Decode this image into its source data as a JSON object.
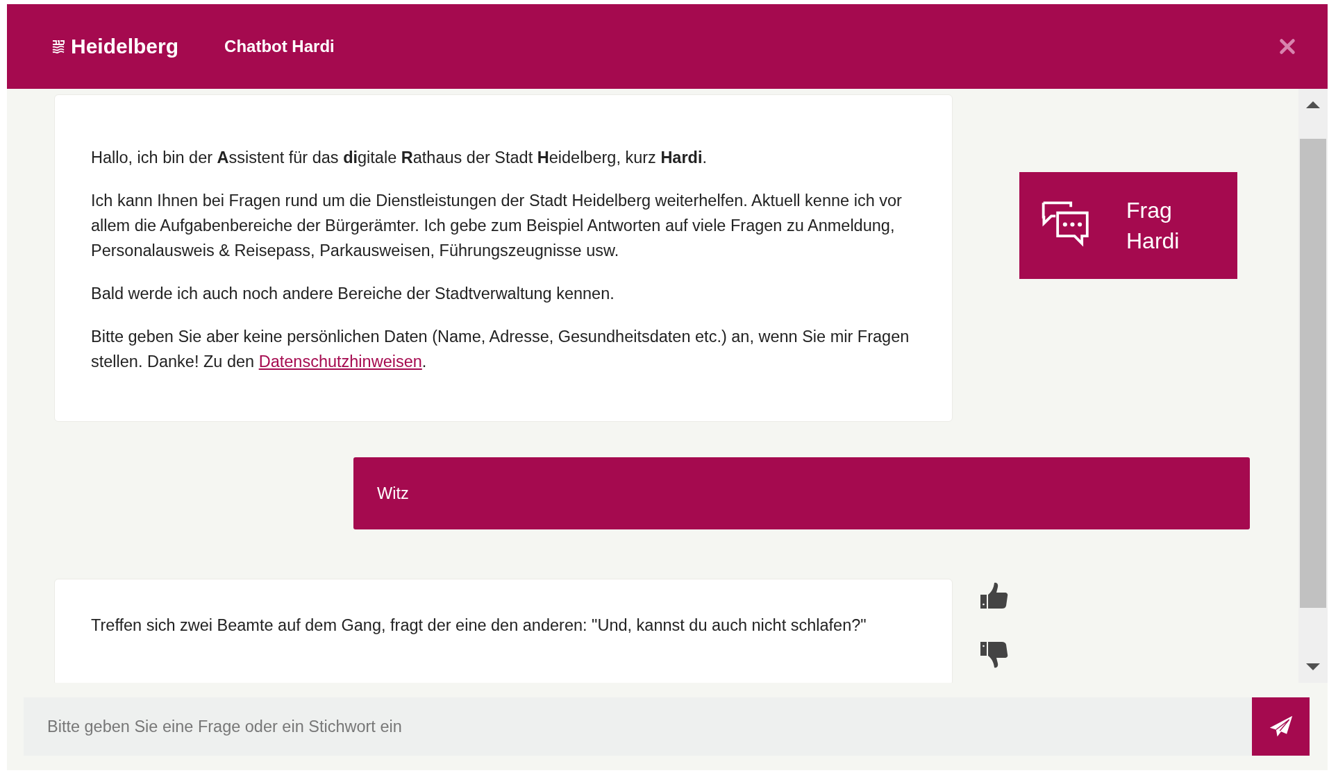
{
  "header": {
    "logo": "Heidelberg",
    "title": "Chatbot Hardi"
  },
  "messages": [
    {
      "kind": "bot",
      "paragraphs": [
        {
          "text": "Hallo, ich bin der **A**ssistent für das **di**gitale **R**athaus der Stadt **H**eidelberg, kurz **Hardi**."
        },
        {
          "text": "Ich kann Ihnen bei Fragen rund um die Dienstleistungen der Stadt Heidelberg weiterhelfen. Aktuell kenne ich vor allem die Aufgabenbereiche der Bürgerämter. Ich gebe zum Beispiel Antworten auf viele Fragen zu Anmeldung, Personalausweis & Reisepass, Parkausweisen, Führungszeugnisse usw."
        },
        {
          "text": "Bald werde ich auch noch andere Bereiche der Stadtverwaltung kennen."
        },
        {
          "text": "Bitte geben Sie aber keine persönlichen Daten (Name, Adresse, Gesundheitsdaten etc.) an, wenn Sie mir Fragen stellen. Danke! Zu den ",
          "link": "Datenschutzhinweisen",
          "after": "."
        }
      ],
      "side_button": {
        "line_1": "Frag",
        "line_2": "Hardi"
      }
    },
    {
      "kind": "user",
      "text": "Witz"
    },
    {
      "kind": "bot",
      "paragraphs": [
        {
          "text": "Treffen sich zwei Beamte auf dem Gang, fragt der eine den anderen: \"Und, kannst du auch nicht schlafen?\""
        }
      ],
      "feedback": true
    }
  ],
  "input": {
    "placeholder": "Bitte geben Sie eine Frage oder ein Stichwort ein"
  }
}
